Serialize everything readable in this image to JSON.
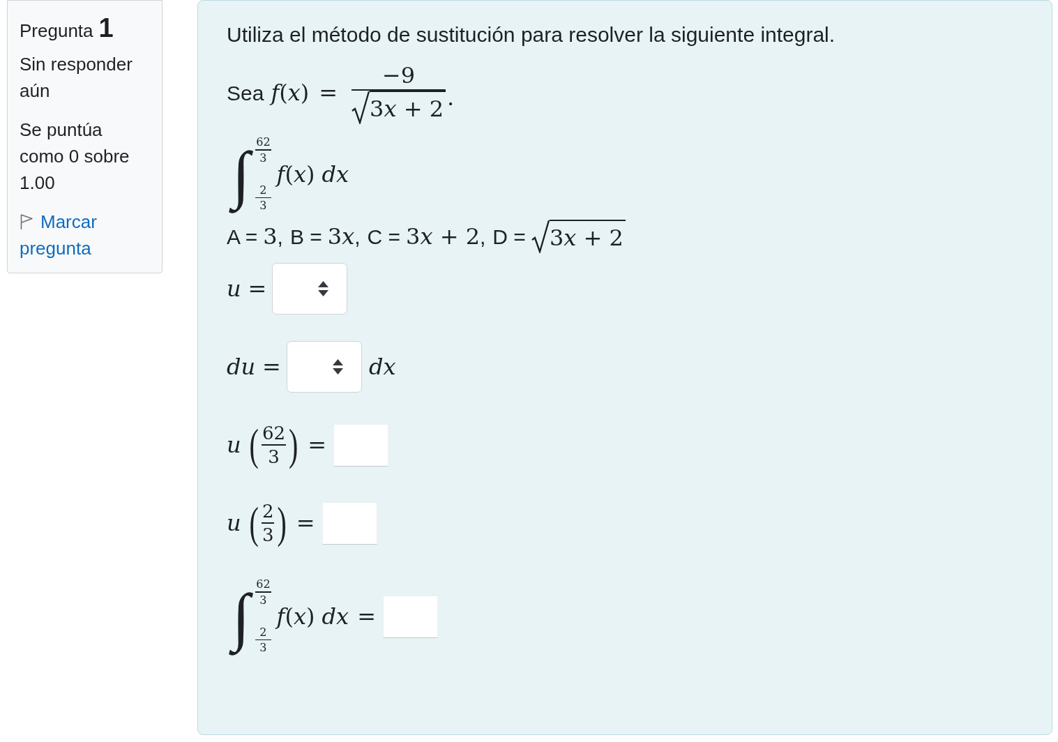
{
  "question_info": {
    "label": "Pregunta",
    "number": "1",
    "status": "Sin responder aún",
    "grade": "Se puntúa como 0 sobre 1.00",
    "flag_link": "Marcar pregunta",
    "flagged": false
  },
  "question": {
    "prompt": "Utiliza el método de sustitución para resolver la siguiente integral.",
    "function": {
      "lead": "Sea",
      "lhs": "f(x)",
      "equals": "=",
      "numerator": "−9",
      "radicand": "3x + 2",
      "end": "."
    },
    "integral": {
      "sign": "∫",
      "upper": {
        "numerator": "62",
        "denominator": "3"
      },
      "lower": {
        "numerator": "2",
        "denominator": "3"
      },
      "integrand": "f(x) dx"
    },
    "definitions": [
      {
        "label": "A =",
        "value": "3",
        "kind": "plain",
        "separator": ","
      },
      {
        "label": "B =",
        "value": "3x",
        "kind": "plain",
        "separator": ","
      },
      {
        "label": "C =",
        "value": "3x + 2",
        "kind": "plain",
        "separator": ","
      },
      {
        "label": "D =",
        "value": "3x + 2",
        "kind": "sqrt"
      }
    ],
    "steps": [
      {
        "kind": "select",
        "lhs": "u",
        "equals": "="
      },
      {
        "kind": "select",
        "lhs": "du",
        "equals": "=",
        "suffix": "dx"
      },
      {
        "kind": "input",
        "lhs": "u",
        "open": "(",
        "argument": {
          "numerator": "62",
          "denominator": "3"
        },
        "close": ")",
        "equals": "="
      },
      {
        "kind": "input",
        "lhs": "u",
        "open": "(",
        "argument": {
          "numerator": "2",
          "denominator": "3"
        },
        "close": ")",
        "equals": "="
      },
      {
        "kind": "integral",
        "sign": "∫",
        "upper": {
          "numerator": "62",
          "denominator": "3"
        },
        "lower": {
          "numerator": "2",
          "denominator": "3"
        },
        "integrand": "f(x) dx",
        "equals": "="
      }
    ]
  }
}
